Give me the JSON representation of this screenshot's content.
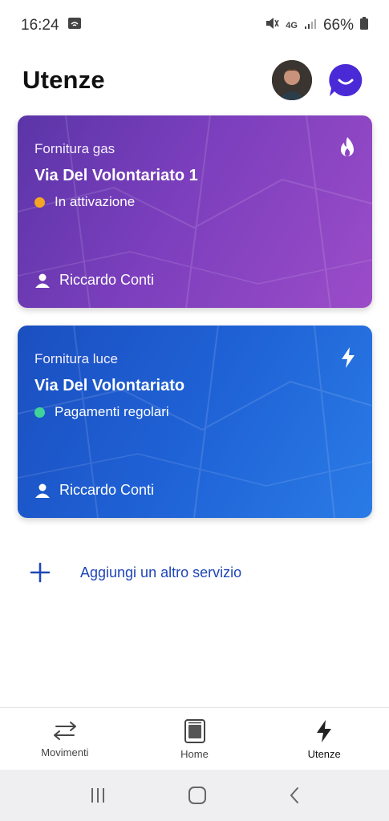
{
  "status_bar": {
    "time": "16:24",
    "battery": "66%",
    "network": "4G"
  },
  "header": {
    "title": "Utenze"
  },
  "cards": [
    {
      "type": "Fornitura gas",
      "address": "Via Del Volontariato 1",
      "status": "In attivazione",
      "status_color": "#f5a524",
      "holder": "Riccardo Conti",
      "icon": "flame-icon"
    },
    {
      "type": "Fornitura luce",
      "address": "Via Del Volontariato",
      "status": "Pagamenti regolari",
      "status_color": "#3fd39a",
      "holder": "Riccardo Conti",
      "icon": "lightning-icon"
    }
  ],
  "add_service": {
    "label": "Aggiungi un altro servizio"
  },
  "bottom_nav": {
    "items": [
      {
        "label": "Movimenti",
        "icon": "transfer-arrows-icon"
      },
      {
        "label": "Home",
        "icon": "home-device-icon"
      },
      {
        "label": "Utenze",
        "icon": "lightning-icon",
        "active": true
      }
    ]
  },
  "colors": {
    "gas_card": "#7c3fbd",
    "luce_card": "#1f62d6",
    "accent": "#1f46b8",
    "assistant": "#4a2ad6"
  }
}
